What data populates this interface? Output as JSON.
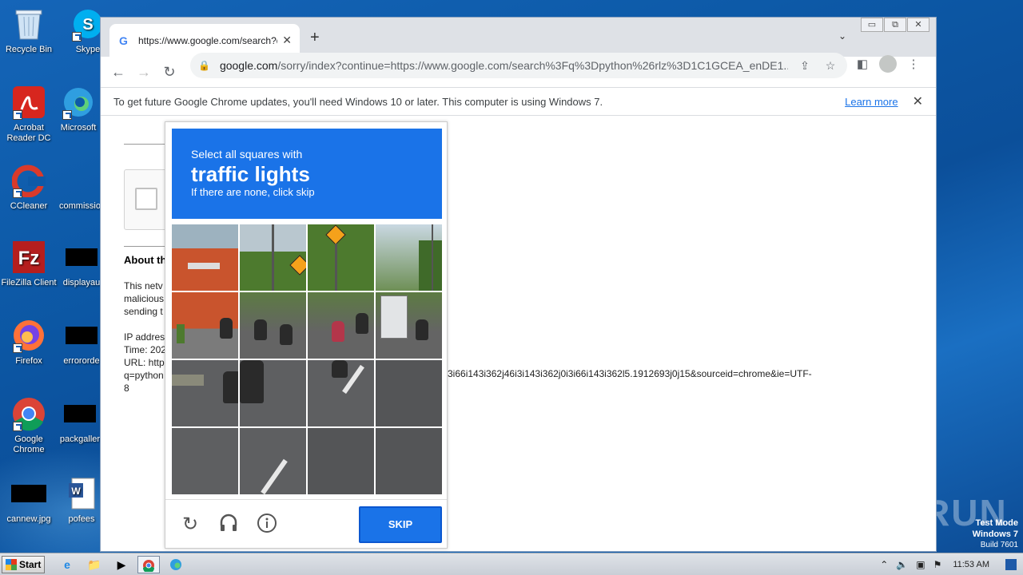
{
  "desktop": {
    "icons": [
      {
        "label": "Recycle Bin"
      },
      {
        "label": "Skype"
      },
      {
        "label": "Acrobat Reader DC"
      },
      {
        "label": "Microsoft"
      },
      {
        "label": "CCleaner"
      },
      {
        "label": "commissio"
      },
      {
        "label": "FileZilla Client"
      },
      {
        "label": "displayau"
      },
      {
        "label": "Firefox"
      },
      {
        "label": "errororde"
      },
      {
        "label": "Google Chrome"
      },
      {
        "label": "packgaller"
      },
      {
        "label": "cannew.jpg"
      },
      {
        "label": "pofees"
      }
    ],
    "watermark": "ANY RUN",
    "testmode": {
      "line1": "Test Mode",
      "line2": "Windows 7",
      "line3": "Build 7601"
    }
  },
  "browser": {
    "tab_title": "https://www.google.com/search?q=",
    "tab_favicon": "G",
    "url_host": "google.com",
    "url_rest": "/sorry/index?continue=https://www.google.com/search%3Fq%3Dpython%26rlz%3D1C1GCEA_enDE1...",
    "infobar_message": "To get future Google Chrome updates, you'll need Windows 10 or later. This computer is using Windows 7.",
    "infobar_link": "Learn more"
  },
  "page": {
    "about_heading": "About th",
    "para1": [
      "This netv",
      "malicious",
      "sending t"
    ],
    "para2": [
      "IP addres",
      "Time: 202",
      "URL: http",
      "q=python"
    ],
    "url_tail": "3i66i143i362j46i3i143i362j0i3i66i143i362l5.1912693j0j15&sourceid=chrome&ie=UTF-",
    "url_tail_line2": "8"
  },
  "captcha": {
    "line1": "Select all squares with",
    "target": "traffic lights",
    "line3": "If there are none, click skip",
    "skip_label": "SKIP"
  },
  "taskbar": {
    "start_label": "Start",
    "clock": "11:53 AM"
  }
}
